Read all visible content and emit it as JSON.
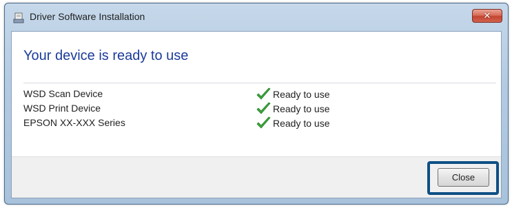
{
  "window": {
    "title": "Driver Software Installation",
    "close_glyph": "✕"
  },
  "main": {
    "heading": "Your device is ready to use",
    "devices": [
      {
        "name": "WSD Scan Device",
        "status": "Ready to use"
      },
      {
        "name": "WSD Print Device",
        "status": "Ready to use"
      },
      {
        "name": "EPSON XX-XXX Series",
        "status": "Ready to use"
      }
    ]
  },
  "footer": {
    "close_label": "Close"
  },
  "icons": {
    "title": "driver-install-icon",
    "status": "green-check-icon",
    "window_close": "close-icon"
  },
  "colors": {
    "heading": "#1b3b9a",
    "check": "#3aa53a",
    "highlight": "#0e4f85",
    "close_x": "#c24530"
  }
}
